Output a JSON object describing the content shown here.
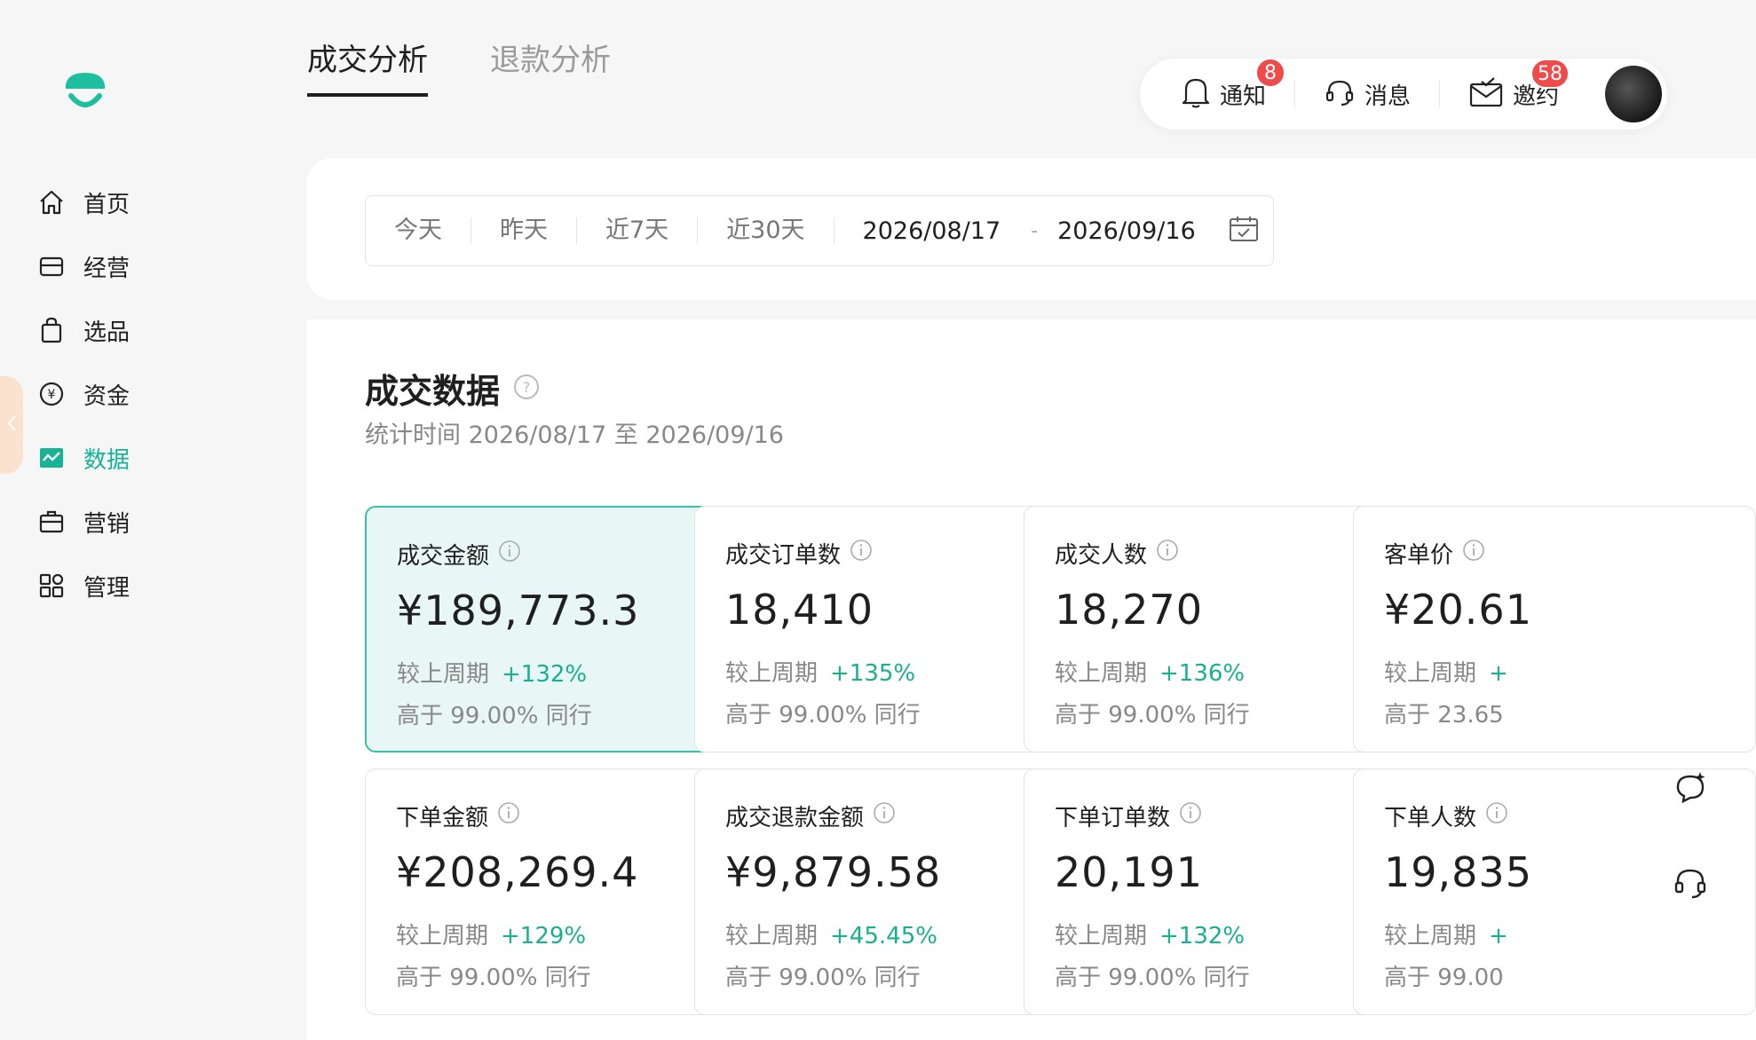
{
  "tabs": [
    {
      "label": "成交分析",
      "active": true
    },
    {
      "label": "退款分析",
      "active": false
    }
  ],
  "toolbar": {
    "notify_label": "通知",
    "notify_badge": "8",
    "message_label": "消息",
    "invite_label": "邀约",
    "invite_badge": "58"
  },
  "sidebar": {
    "items": [
      {
        "label": "首页",
        "icon": "home-icon"
      },
      {
        "label": "经营",
        "icon": "store-icon"
      },
      {
        "label": "选品",
        "icon": "bag-icon"
      },
      {
        "label": "资金",
        "icon": "yuan-icon"
      },
      {
        "label": "数据",
        "icon": "chart-icon",
        "active": true
      },
      {
        "label": "营销",
        "icon": "briefcase-icon"
      },
      {
        "label": "管理",
        "icon": "grid-icon"
      }
    ]
  },
  "filter": {
    "quick": [
      "今天",
      "昨天",
      "近7天",
      "近30天"
    ],
    "start_date": "2026/08/17",
    "separator": "-",
    "end_date": "2026/09/16"
  },
  "section": {
    "title": "成交数据",
    "subtitle": "统计时间 2026/08/17 至 2026/09/16"
  },
  "cards": [
    {
      "title": "成交金额",
      "value": "¥189,773.3",
      "compare_label": "较上周期",
      "delta": "+132%",
      "rank": "高于 99.00% 同行"
    },
    {
      "title": "成交订单数",
      "value": "18,410",
      "compare_label": "较上周期",
      "delta": "+135%",
      "rank": "高于 99.00% 同行"
    },
    {
      "title": "成交人数",
      "value": "18,270",
      "compare_label": "较上周期",
      "delta": "+136%",
      "rank": "高于 99.00% 同行"
    },
    {
      "title": "客单价",
      "value": "¥20.61",
      "compare_label": "较上周期",
      "delta": "+",
      "rank": "高于 23.65"
    },
    {
      "title": "下单金额",
      "value": "¥208,269.4",
      "compare_label": "较上周期",
      "delta": "+129%",
      "rank": "高于 99.00% 同行"
    },
    {
      "title": "成交退款金额",
      "value": "¥9,879.58",
      "compare_label": "较上周期",
      "delta": "+45.45%",
      "rank": "高于 99.00% 同行"
    },
    {
      "title": "下单订单数",
      "value": "20,191",
      "compare_label": "较上周期",
      "delta": "+132%",
      "rank": "高于 99.00% 同行"
    },
    {
      "title": "下单人数",
      "value": "19,835",
      "compare_label": "较上周期",
      "delta": "+",
      "rank": "高于 99.00"
    }
  ],
  "colors": {
    "accent": "#16b396",
    "selected_card_bg": "#e8f7f5",
    "badge": "#f04b4b"
  }
}
